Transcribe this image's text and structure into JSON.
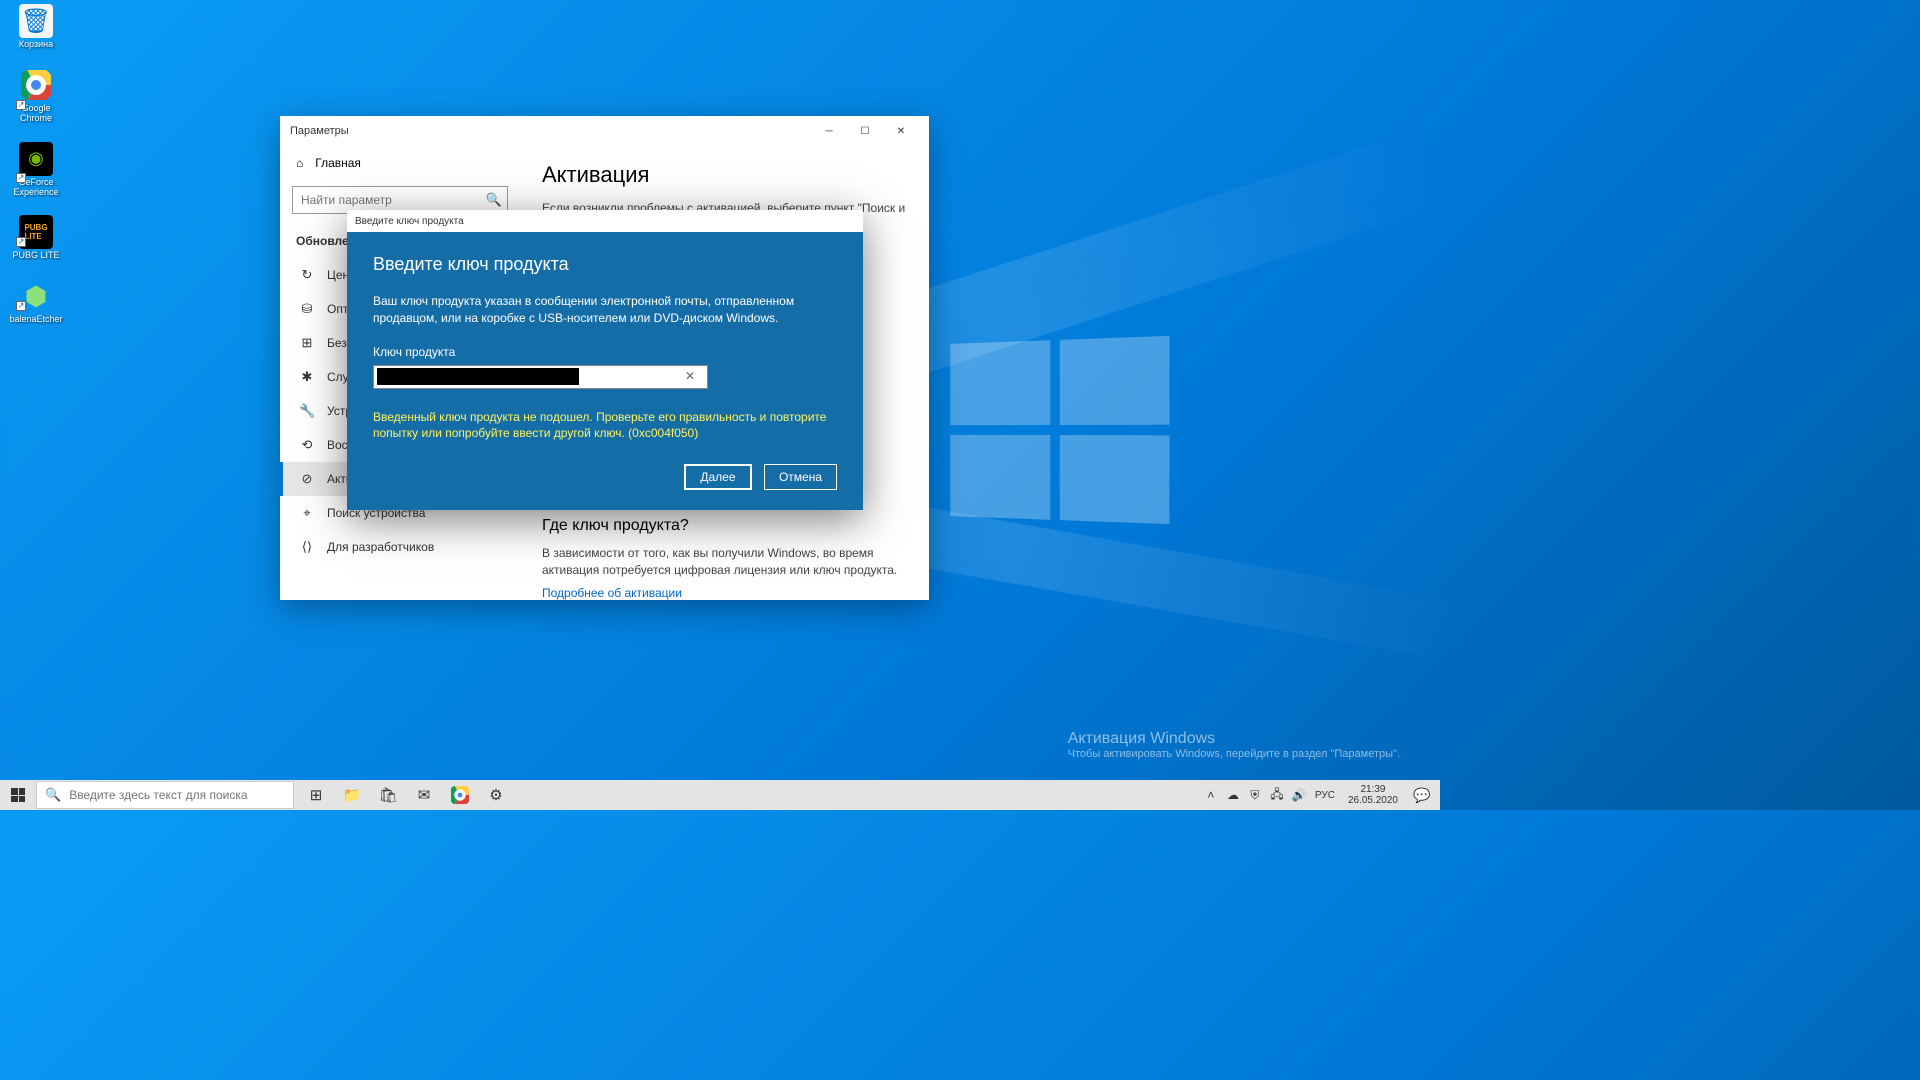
{
  "desktop": {
    "icons": [
      {
        "label": "Корзина"
      },
      {
        "label": "Google Chrome"
      },
      {
        "label": "GeForce Experience"
      },
      {
        "label": "PUBG LITE"
      },
      {
        "label": "balenaEtcher"
      }
    ]
  },
  "watermark": {
    "line1": "Активация Windows",
    "line2": "Чтобы активировать Windows, перейдите в раздел \"Параметры\"."
  },
  "settings": {
    "title": "Параметры",
    "home": "Главная",
    "search_placeholder": "Найти параметр",
    "category": "Обновлени",
    "nav": [
      {
        "icon": "↻",
        "label": "Центр"
      },
      {
        "icon": "⛁",
        "label": "Оптим"
      },
      {
        "icon": "⊞",
        "label": "Безопа"
      },
      {
        "icon": "✱",
        "label": "Служба"
      },
      {
        "icon": "🔧",
        "label": "Устран"
      },
      {
        "icon": "⟲",
        "label": "Восста"
      },
      {
        "icon": "⊘",
        "label": "Активация"
      },
      {
        "icon": "⌖",
        "label": "Поиск устройства"
      },
      {
        "icon": "⟨⟩",
        "label": "Для разработчиков"
      }
    ],
    "content": {
      "h1": "Активация",
      "body1": "Если возникли проблемы с активацией, выберите пункт \"Поиск и",
      "h2": "Где ключ продукта?",
      "body2": "В зависимости от того, как вы получили Windows, во время активация потребуется цифровая лицензия или ключ продукта.",
      "link": "Подробнее об активации"
    }
  },
  "modal": {
    "title": "Введите ключ продукта",
    "heading": "Введите ключ продукта",
    "desc": "Ваш ключ продукта указан в сообщении электронной почты, отправленном продавцом, или на коробке с USB-носителем или DVD-диском Windows.",
    "field_label": "Ключ продукта",
    "error": "Введенный ключ продукта не подошел. Проверьте его правильность и повторите попытку или попробуйте ввести другой ключ. (0xc004f050)",
    "btn_next": "Далее",
    "btn_cancel": "Отмена"
  },
  "taskbar": {
    "search_placeholder": "Введите здесь текст для поиска",
    "lang": "РУС",
    "time": "21:39",
    "date": "26.05.2020"
  }
}
